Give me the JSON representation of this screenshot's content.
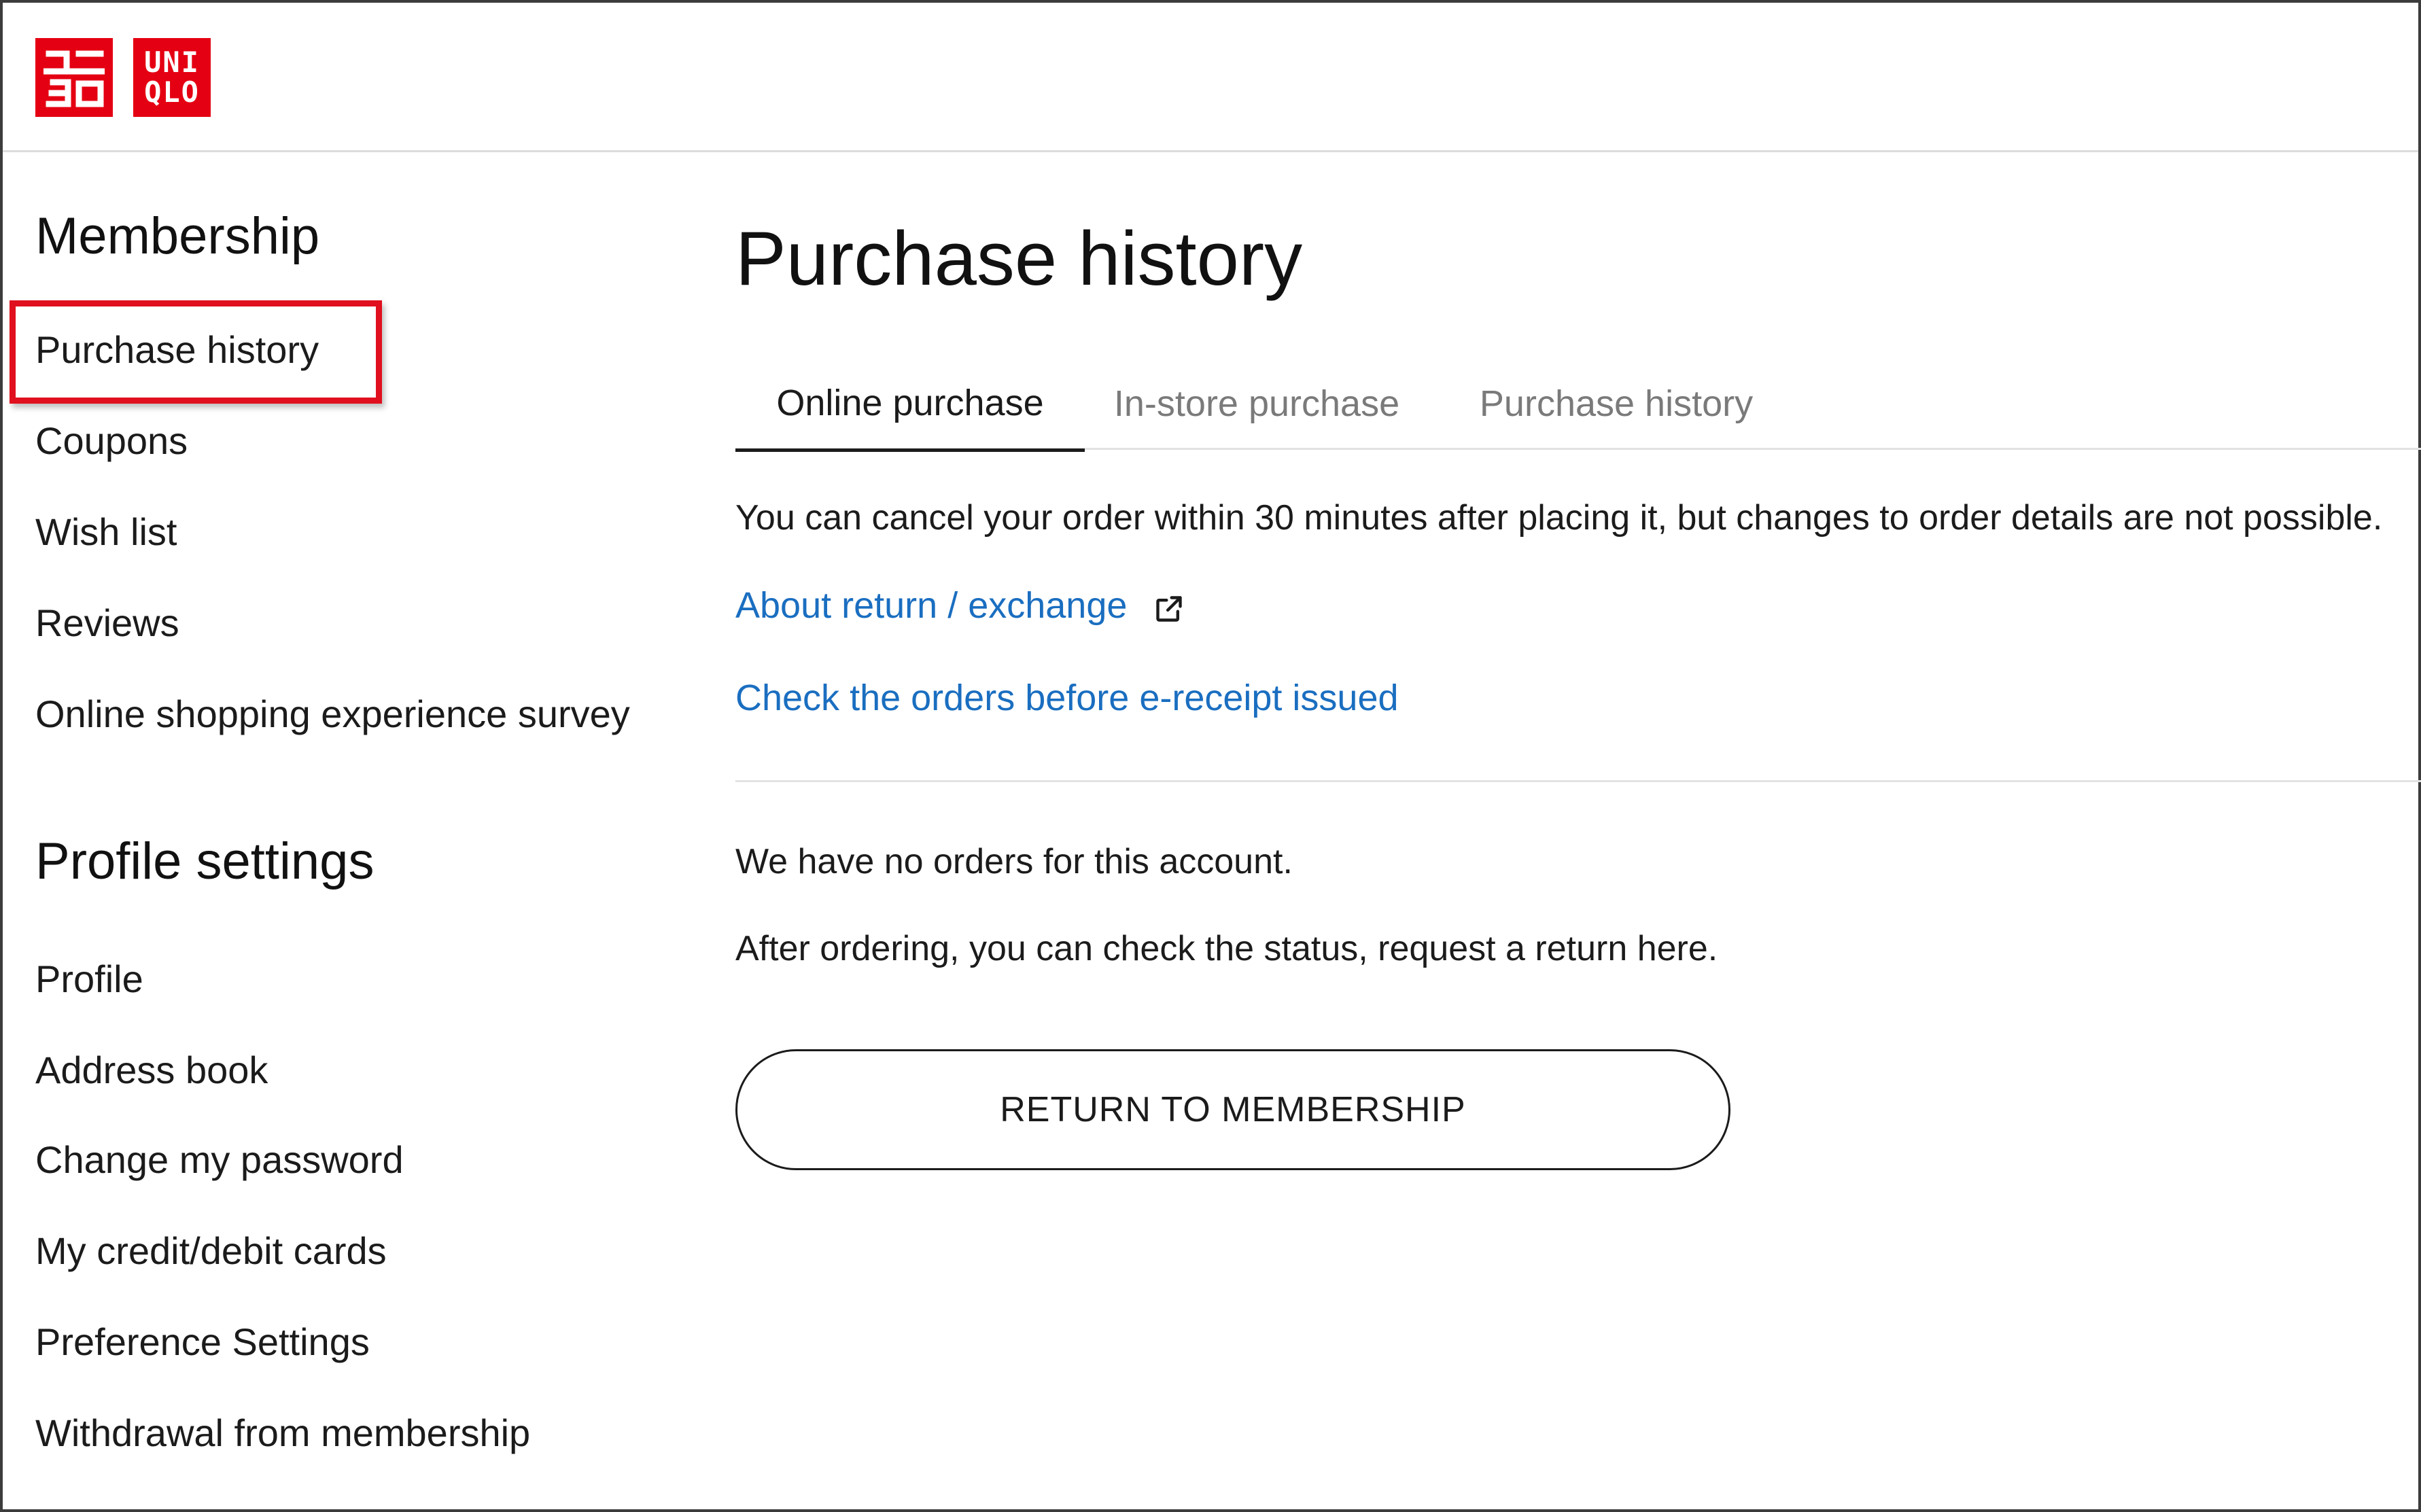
{
  "header": {
    "logo_text_top": "UNI",
    "logo_text_bottom": "QLO",
    "brand_color": "#e40012"
  },
  "sidebar": {
    "membership_heading": "Membership",
    "membership_items": [
      {
        "label": "Purchase history",
        "highlighted": true
      },
      {
        "label": "Coupons"
      },
      {
        "label": "Wish list"
      },
      {
        "label": "Reviews"
      },
      {
        "label": "Online shopping experience survey"
      }
    ],
    "profile_heading": "Profile settings",
    "profile_items": [
      {
        "label": "Profile"
      },
      {
        "label": "Address book"
      },
      {
        "label": "Change my password"
      },
      {
        "label": "My credit/debit cards"
      },
      {
        "label": "Preference Settings"
      },
      {
        "label": "Withdrawal from membership"
      }
    ],
    "highlight_color": "#e0101e"
  },
  "main": {
    "title": "Purchase history",
    "tabs": [
      {
        "label": "Online purchase",
        "active": true
      },
      {
        "label": "In-store purchase",
        "active": false
      },
      {
        "label": "Purchase history",
        "active": false
      }
    ],
    "notice": "You can cancel your order within 30 minutes after placing it, but changes to order details are not possible.",
    "links": {
      "return_exchange": "About return / exchange",
      "external_icon": "external-link-icon",
      "check_orders": "Check the orders before e-receipt issued",
      "link_color": "#1a6ec0"
    },
    "empty_message": "We have no orders for this account.",
    "empty_hint": "After ordering, you can check the status, request a return here.",
    "return_button": "RETURN TO MEMBERSHIP"
  }
}
